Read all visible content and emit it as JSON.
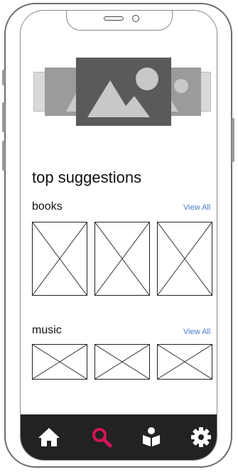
{
  "page": {
    "title": "top suggestions"
  },
  "sections": [
    {
      "label": "books",
      "view_all": "View All"
    },
    {
      "label": "music",
      "view_all": "View All"
    }
  ],
  "tab_bar": {
    "active_tab": "search",
    "accent_color": "#d4145a",
    "tabs": [
      {
        "name": "home",
        "icon": "home-icon"
      },
      {
        "name": "search",
        "icon": "search-icon"
      },
      {
        "name": "reading",
        "icon": "book-reader-icon"
      },
      {
        "name": "settings",
        "icon": "gear-icon"
      }
    ]
  }
}
